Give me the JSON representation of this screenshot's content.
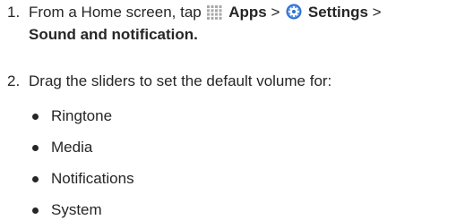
{
  "steps": [
    {
      "number": "1.",
      "intro": "From a Home screen, tap",
      "apps_label": "Apps",
      "sep1": ">",
      "settings_label": "Settings",
      "sep2": ">",
      "target_label": "Sound and notification."
    },
    {
      "number": "2.",
      "text": "Drag the sliders to set the default volume for:"
    }
  ],
  "bullets": [
    "Ringtone",
    "Media",
    "Notifications",
    "System"
  ],
  "icons": {
    "apps": "apps-grid-icon",
    "settings": "settings-gear-icon"
  },
  "colors": {
    "text": "#262626",
    "apps_icon": "#a8a8a8",
    "settings_icon": "#2f6fd1"
  }
}
